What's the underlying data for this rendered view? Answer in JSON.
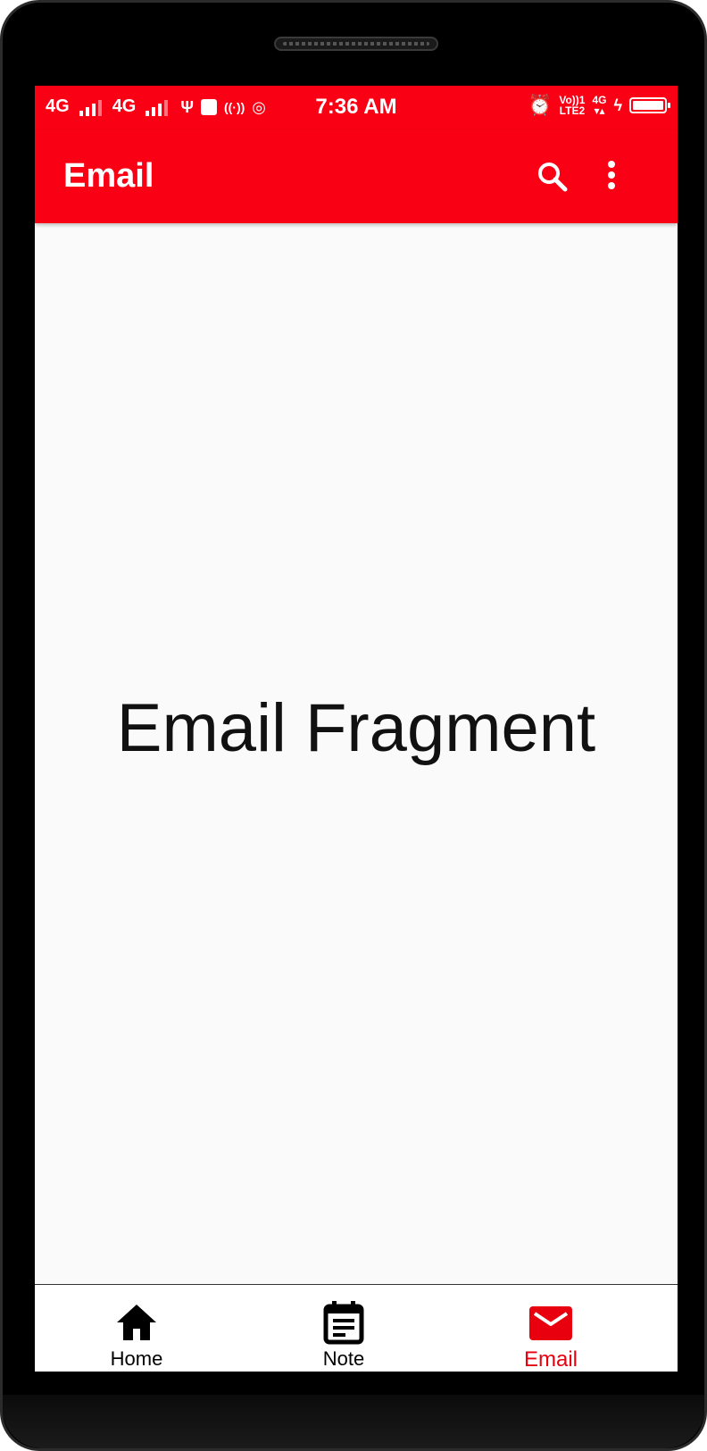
{
  "status_bar": {
    "network_1": "4G",
    "network_2": "4G",
    "time": "7:36 AM",
    "volte_line1": "Vo))1",
    "volte_line2": "LTE2",
    "data_type": "4G"
  },
  "app_bar": {
    "title": "Email"
  },
  "content": {
    "fragment_text": "Email Fragment"
  },
  "bottom_nav": {
    "items": [
      {
        "label": "Home",
        "icon": "home-icon",
        "active": false
      },
      {
        "label": "Note",
        "icon": "note-icon",
        "active": false
      },
      {
        "label": "Email",
        "icon": "email-icon",
        "active": true
      }
    ]
  },
  "colors": {
    "accent": "#fa0015",
    "active_tab": "#e8000f",
    "background": "#fafafa"
  }
}
